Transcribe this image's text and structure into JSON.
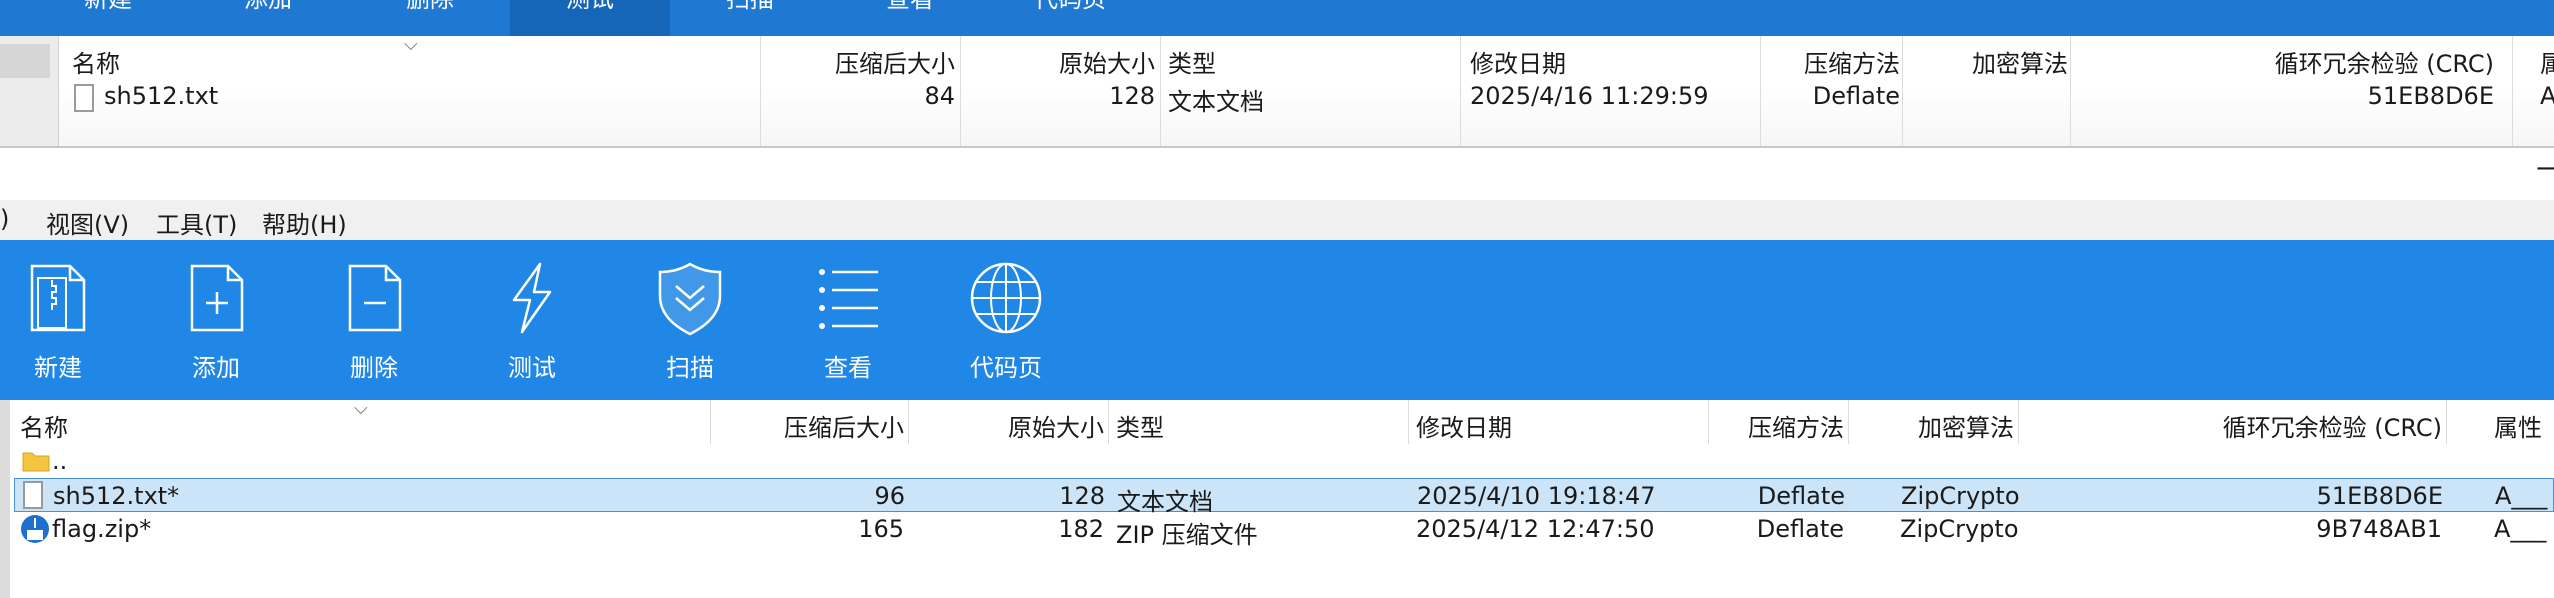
{
  "top_window": {
    "toolbar": [
      "新建",
      "添加",
      "删除",
      "测试",
      "扫描",
      "查看",
      "代码页"
    ],
    "columns": {
      "name": "名称",
      "packed": "压缩后大小",
      "size": "原始大小",
      "type": "类型",
      "modified": "修改日期",
      "method": "压缩方法",
      "encryption": "加密算法",
      "crc": "循环冗余检验 (CRC)",
      "attr": "属"
    },
    "row": {
      "name": "sh512.txt",
      "packed": "84",
      "size": "128",
      "type": "文本文档",
      "modified": "2025/4/16 11:29:59",
      "method": "Deflate",
      "encryption": "",
      "crc": "51EB8D6E",
      "attr": "A"
    }
  },
  "window": {
    "minimize_glyph": "—"
  },
  "menu": [
    ")",
    "视图(V)",
    "工具(T)",
    "帮助(H)"
  ],
  "toolbar": [
    {
      "label": "新建",
      "icon": "new-archive-icon"
    },
    {
      "label": "添加",
      "icon": "add-file-icon"
    },
    {
      "label": "删除",
      "icon": "delete-file-icon"
    },
    {
      "label": "测试",
      "icon": "lightning-icon"
    },
    {
      "label": "扫描",
      "icon": "shield-icon"
    },
    {
      "label": "查看",
      "icon": "list-view-icon"
    },
    {
      "label": "代码页",
      "icon": "globe-icon"
    }
  ],
  "columns": {
    "name": "名称",
    "packed": "压缩后大小",
    "size": "原始大小",
    "type": "类型",
    "modified": "修改日期",
    "method": "压缩方法",
    "encryption": "加密算法",
    "crc": "循环冗余检验 (CRC)",
    "attr": "属性"
  },
  "rows": [
    {
      "name": "..",
      "icon": "folder-icon",
      "packed": "",
      "size": "",
      "type": "",
      "modified": "",
      "method": "",
      "encryption": "",
      "crc": "",
      "attr": ""
    },
    {
      "name": "sh512.txt*",
      "icon": "text-file-icon",
      "packed": "96",
      "size": "128",
      "type": "文本文档",
      "modified": "2025/4/10 19:18:47",
      "method": "Deflate",
      "encryption": "ZipCrypto",
      "crc": "51EB8D6E",
      "attr": "A___"
    },
    {
      "name": "flag.zip*",
      "icon": "zip-file-icon",
      "packed": "165",
      "size": "182",
      "type": "ZIP 压缩文件",
      "modified": "2025/4/12 12:47:50",
      "method": "Deflate",
      "encryption": "ZipCrypto",
      "crc": "9B748AB1",
      "attr": "A___"
    }
  ],
  "colors": {
    "toolbar_blue": "#2087e6",
    "selection": "#cce4f7"
  }
}
